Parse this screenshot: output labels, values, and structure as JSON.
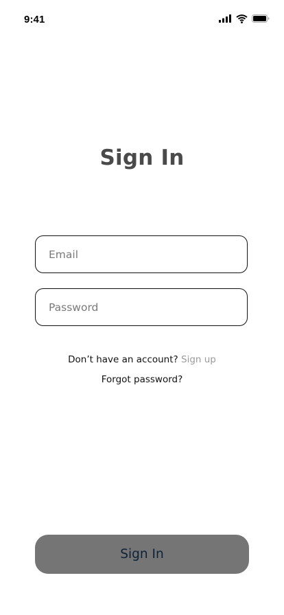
{
  "status_bar": {
    "time": "9:41",
    "icons": [
      "cellular-signal-icon",
      "wifi-icon",
      "battery-icon"
    ]
  },
  "page": {
    "title": "Sign In"
  },
  "form": {
    "email_placeholder": "Email",
    "email_value": "",
    "password_placeholder": "Password",
    "password_value": ""
  },
  "links": {
    "no_account_text": "Don’t have an account?",
    "signup_label": "Sign up",
    "forgot_password_label": "Forgot password?"
  },
  "actions": {
    "signin_label": "Sign In"
  },
  "colors": {
    "title": "#4a4a4a",
    "button_bg": "#757575",
    "button_text": "#0d2238",
    "link_muted": "#9a9a9a"
  }
}
